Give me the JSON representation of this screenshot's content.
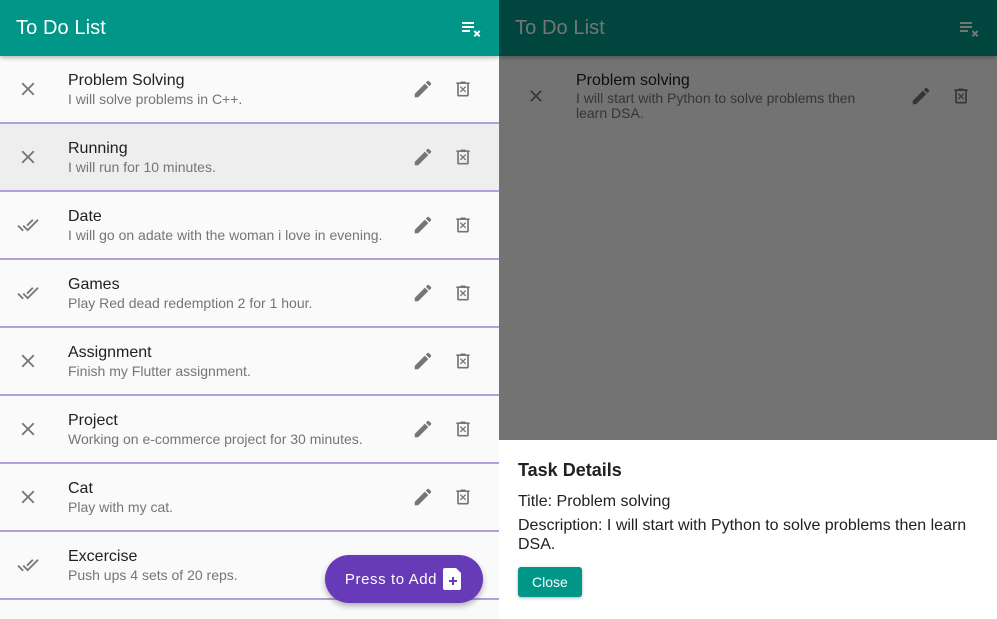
{
  "theme": {
    "appbar_color": "#009688",
    "list_divider_color": "#b39ddb",
    "fab_color": "#673ab7",
    "icon_color": "#757575"
  },
  "left": {
    "title": "To Do List",
    "clear_action_icon": "clear-all-icon",
    "tasks": [
      {
        "status_icon": "close-icon",
        "title": "Problem Solving",
        "description": "I will solve problems in C++."
      },
      {
        "status_icon": "close-icon",
        "title": "Running",
        "description": "I will run for 10 minutes."
      },
      {
        "status_icon": "done-all-icon",
        "title": "Date",
        "description": "I will go on adate with the woman i love in evening."
      },
      {
        "status_icon": "done-all-icon",
        "title": "Games",
        "description": "Play Red dead redemption 2 for 1 hour."
      },
      {
        "status_icon": "close-icon",
        "title": "Assignment",
        "description": "Finish my Flutter assignment."
      },
      {
        "status_icon": "close-icon",
        "title": "Project",
        "description": "Working on e-commerce project for 30 minutes."
      },
      {
        "status_icon": "close-icon",
        "title": "Cat",
        "description": "Play with my cat."
      },
      {
        "status_icon": "done-all-icon",
        "title": "Excercise",
        "description": "Push ups 4 sets of 20 reps."
      }
    ],
    "fab_label": "Press to Add",
    "fab_icon": "note-add-icon"
  },
  "right": {
    "title": "To Do List",
    "task": {
      "status_icon": "close-icon",
      "title": "Problem solving",
      "description": "I will start with Python to solve problems then learn DSA."
    },
    "sheet": {
      "heading": "Task Details",
      "title_line": "Title: Problem solving",
      "description_line": "Description: I will start with Python to solve problems then learn DSA.",
      "close_label": "Close"
    }
  }
}
